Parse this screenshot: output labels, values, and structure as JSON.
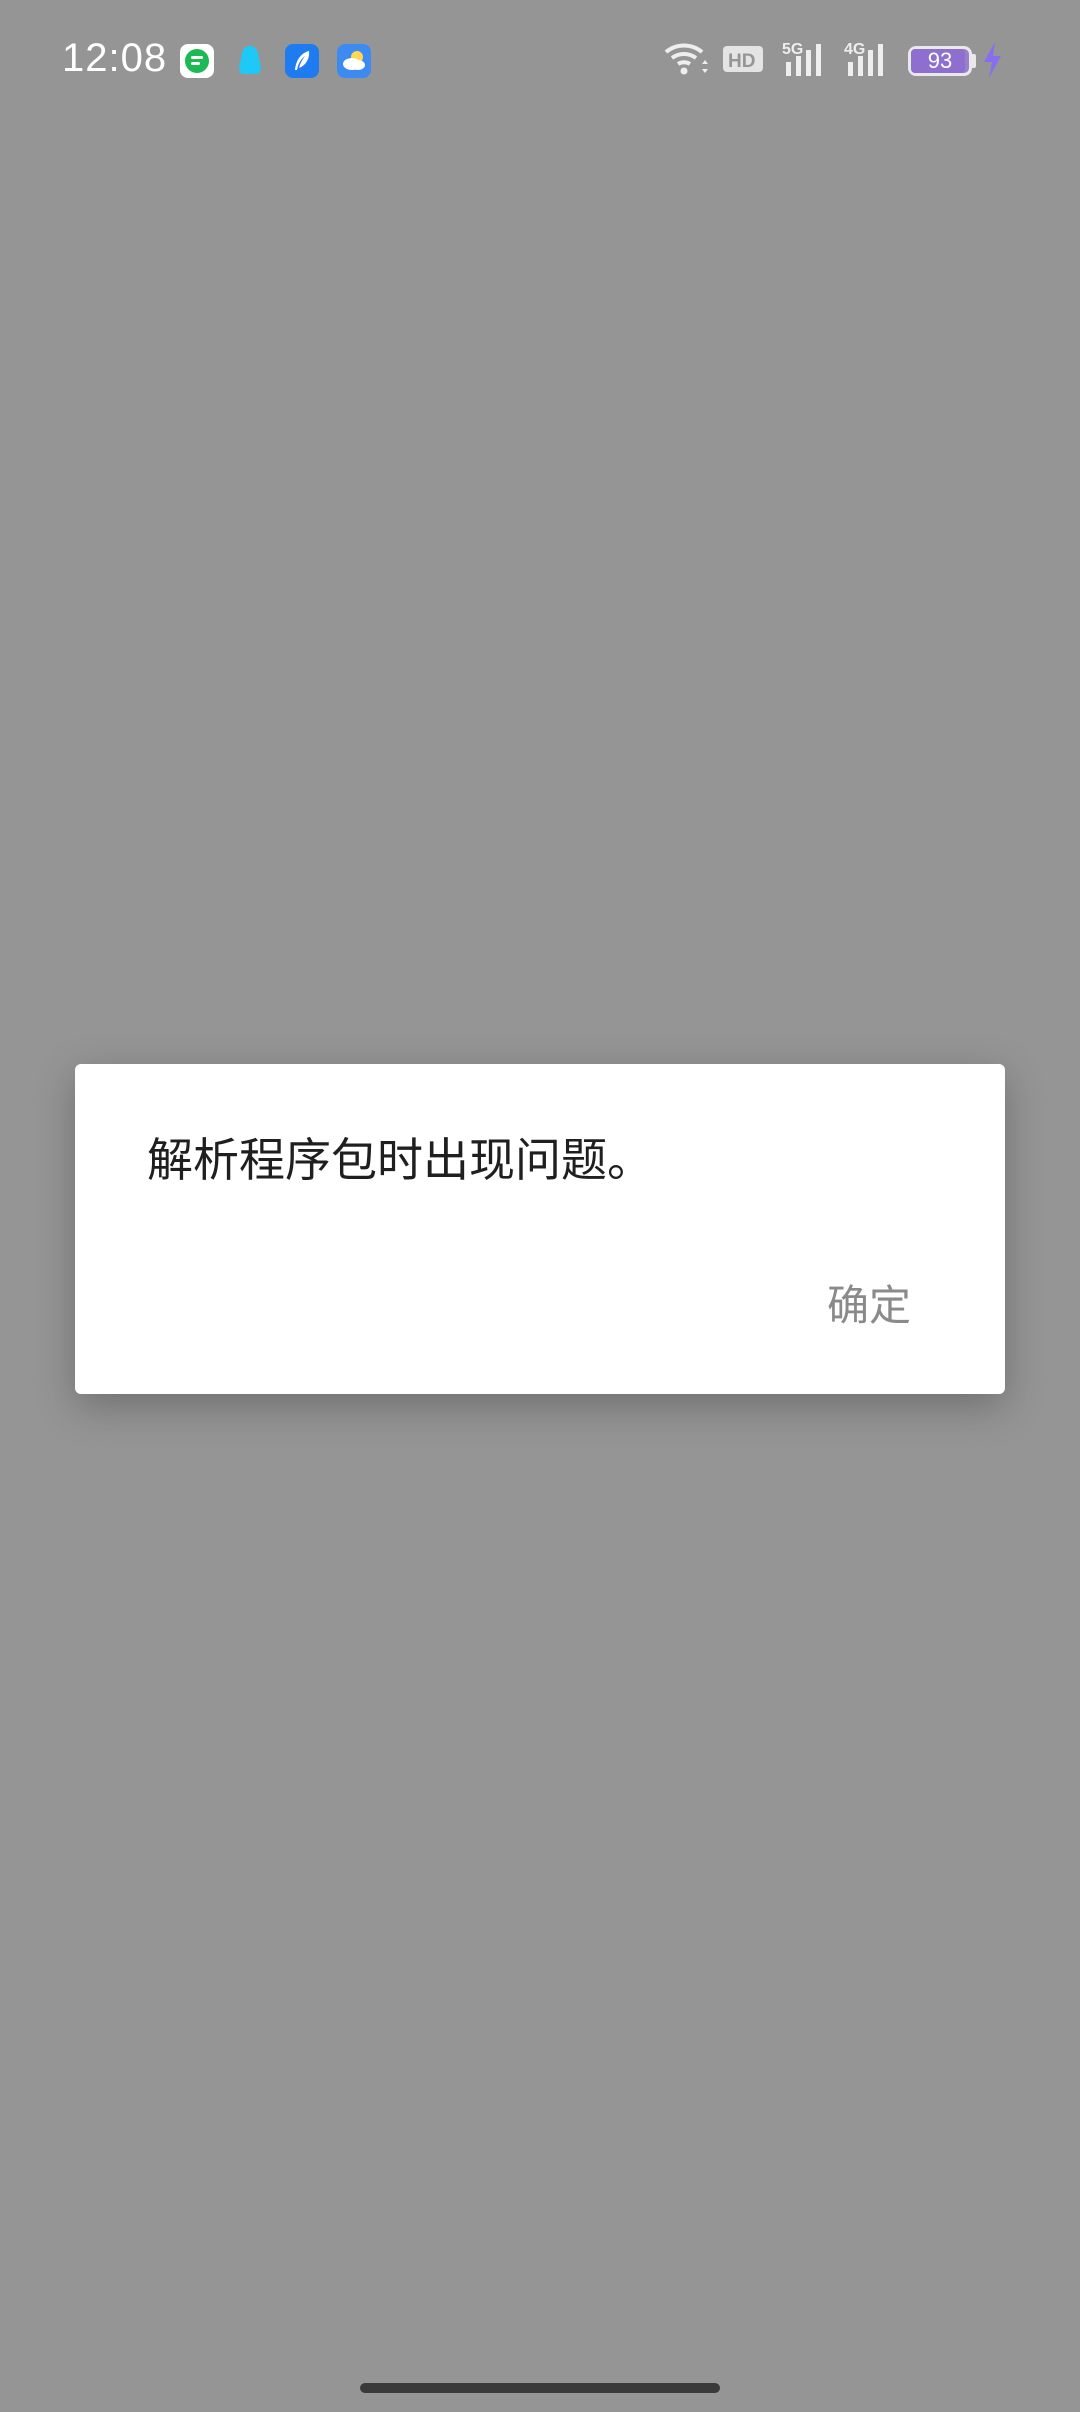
{
  "status_bar": {
    "time": "12:08",
    "notification_icons": [
      "chat-app-icon",
      "qq-penguin-icon",
      "feather-app-icon",
      "weather-icon"
    ],
    "hd_label": "HD",
    "network_5g": "5G",
    "network_4g": "4G",
    "battery_percent": "93",
    "battery_level": 0.93,
    "charging": true,
    "colors": {
      "battery_fill": "#8e6fd0",
      "charging_bolt": "#8a6cf0",
      "chat_icon_green": "#1db954",
      "qq_icon_cyan": "#1ec8f7",
      "feather_icon_blue": "#1f7bf0",
      "weather_icon_blue": "#3d8bf2"
    }
  },
  "dialog": {
    "message": "解析程序包时出现问题。",
    "ok_label": "确定"
  },
  "background_color": "#959595"
}
